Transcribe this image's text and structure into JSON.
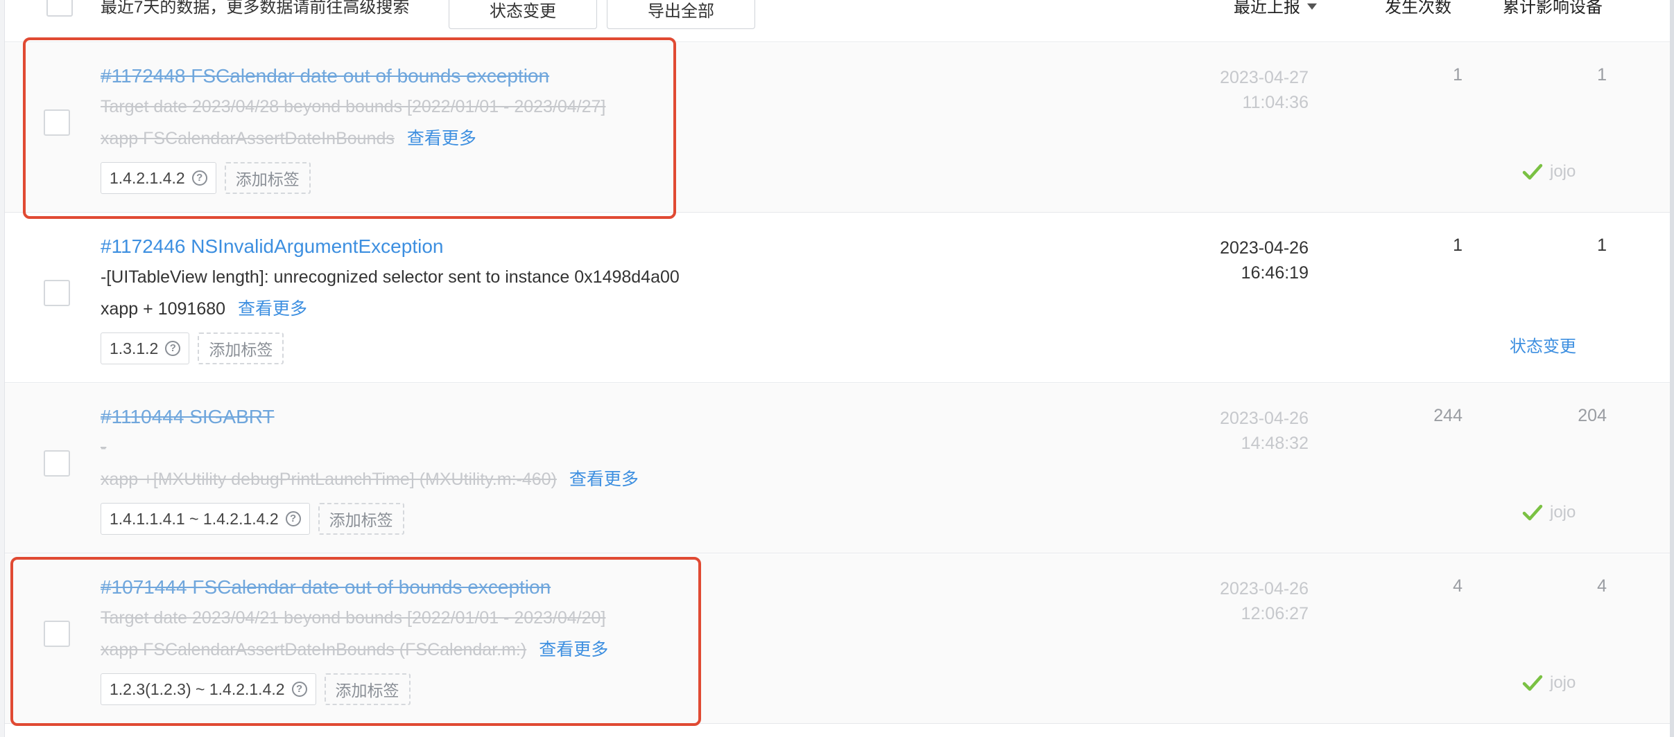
{
  "header": {
    "hint": "最近7天的数据，更多数据请前往高级搜索",
    "status_button": "状态变更",
    "export_button": "导出全部",
    "col_latest": "最近上报",
    "col_count": "发生次数",
    "col_devices": "累计影响设备"
  },
  "rows": [
    {
      "title": "#1172448 FSCalendar date out of bounds exception",
      "line1": "Target date 2023/04/28 beyond bounds [2022/01/01 - 2023/04/27]",
      "line2": "xapp FSCalendarAssertDateInBounds",
      "more": "查看更多",
      "version": "1.4.2.1.4.2",
      "add_tag": "添加标签",
      "date": "2023-04-27",
      "time": "11:04:36",
      "count": "1",
      "devices": "1",
      "owner": "jojo",
      "status": "resolved"
    },
    {
      "title": "#1172446 NSInvalidArgumentException",
      "line1": "-[UITableView length]: unrecognized selector sent to instance 0x1498d4a00",
      "line2": "xapp + 1091680",
      "more": "查看更多",
      "version": "1.3.1.2",
      "add_tag": "添加标签",
      "date": "2023-04-26",
      "time": "16:46:19",
      "count": "1",
      "devices": "1",
      "action": "状态变更",
      "status": "open"
    },
    {
      "title": "#1110444 SIGABRT",
      "line1": "-",
      "line2": "xapp +[MXUtility debugPrintLaunchTime] (MXUtility.m:-460)",
      "more": "查看更多",
      "version": "1.4.1.1.4.1 ~ 1.4.2.1.4.2",
      "add_tag": "添加标签",
      "date": "2023-04-26",
      "time": "14:48:32",
      "count": "244",
      "devices": "204",
      "owner": "jojo",
      "status": "resolved"
    },
    {
      "title": "#1071444 FSCalendar date out of bounds exception",
      "line1": "Target date 2023/04/21 beyond bounds [2022/01/01 - 2023/04/20]",
      "line2": "xapp FSCalendarAssertDateInBounds (FSCalendar.m:)",
      "more": "查看更多",
      "version": "1.2.3(1.2.3) ~ 1.4.2.1.4.2",
      "add_tag": "添加标签",
      "date": "2023-04-26",
      "time": "12:06:27",
      "count": "4",
      "devices": "4",
      "owner": "jojo",
      "status": "resolved"
    }
  ],
  "colors": {
    "link": "#3d8fe0",
    "resolved_text": "#c6c8cc",
    "check": "#7ac143",
    "highlight": "#e04a33"
  }
}
